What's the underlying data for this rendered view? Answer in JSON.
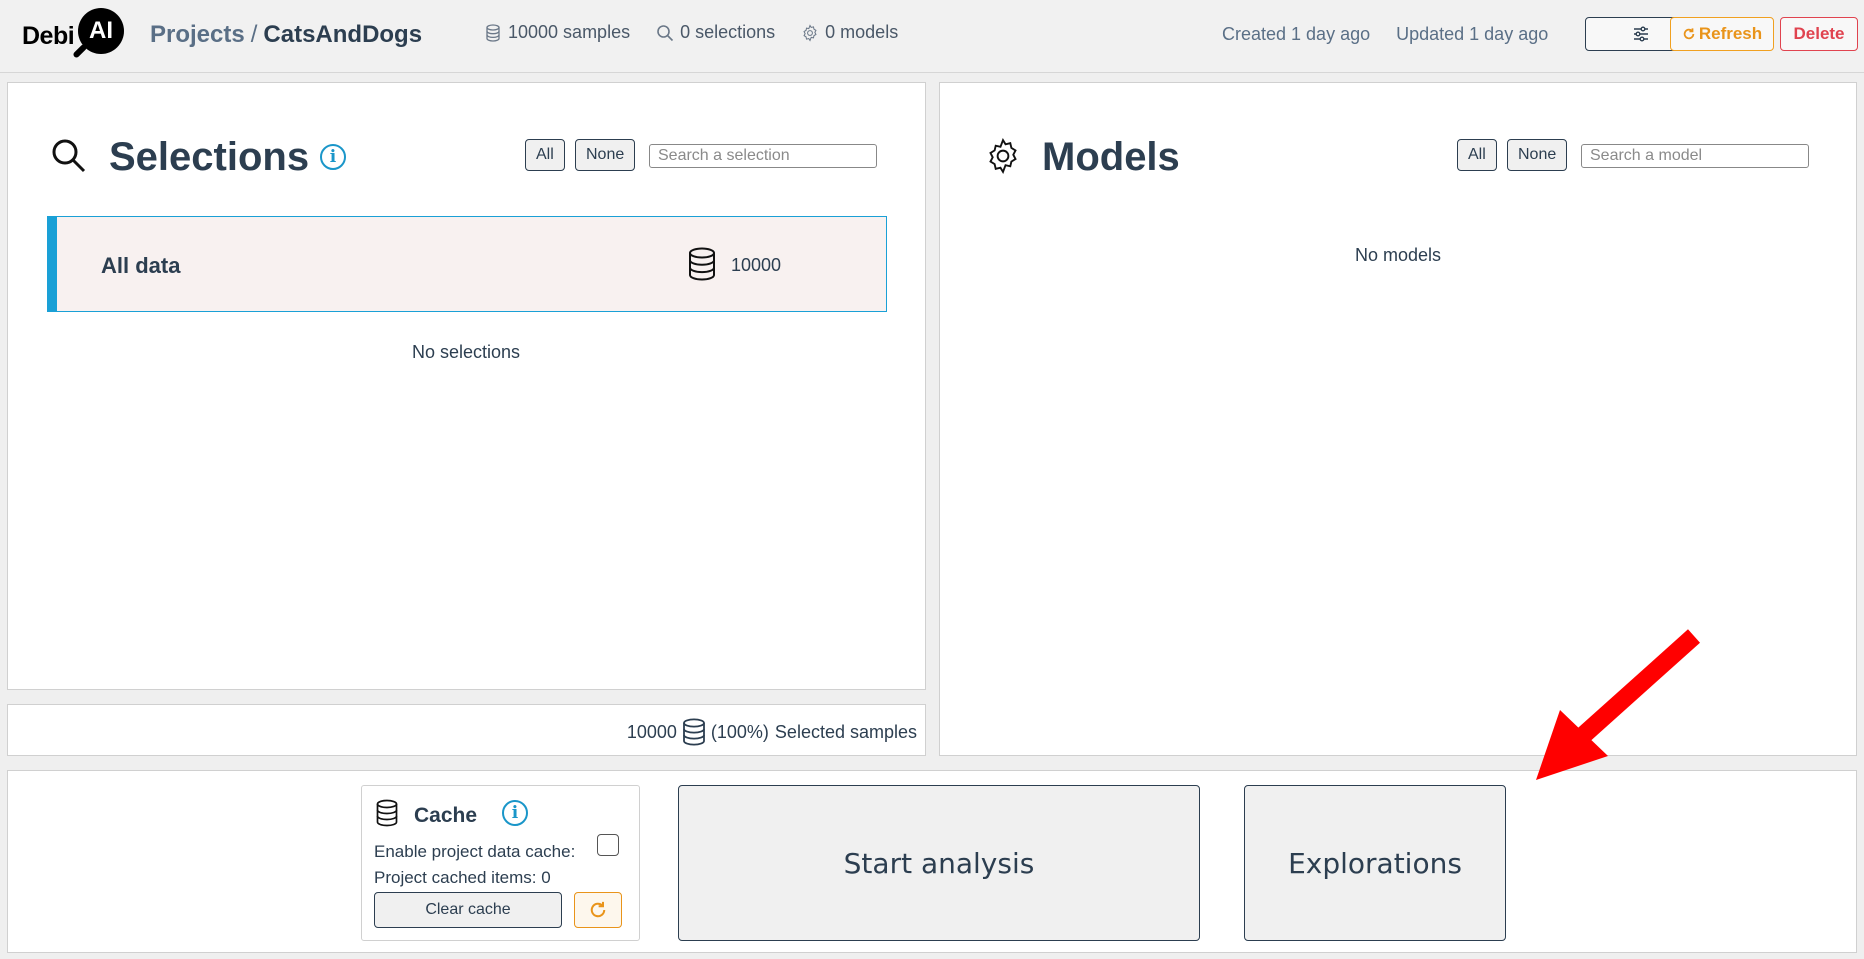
{
  "header": {
    "logo_text": "Debi",
    "logo_badge": "AI",
    "breadcrumb": {
      "parent": "Projects",
      "separator": "/",
      "current": "CatsAndDogs"
    },
    "stats": {
      "samples": "10000 samples",
      "selections": "0 selections",
      "models": "0 models"
    },
    "created": "Created 1 day ago",
    "updated": "Updated 1 day ago",
    "refresh_label": "Refresh",
    "delete_label": "Delete"
  },
  "selections": {
    "title": "Selections",
    "info_label": "i",
    "all_label": "All",
    "none_label": "None",
    "search_placeholder": "Search a selection",
    "all_data_label": "All data",
    "all_data_count": "10000",
    "empty_text": "No selections",
    "footer": {
      "count": "10000",
      "percent": "(100%)",
      "label": "Selected samples"
    }
  },
  "models": {
    "title": "Models",
    "all_label": "All",
    "none_label": "None",
    "search_placeholder": "Search a model",
    "empty_text": "No models"
  },
  "cache": {
    "title": "Cache",
    "info_label": "i",
    "enable_label": "Enable project data cache:",
    "enabled": false,
    "cached_items": "Project cached items: 0",
    "clear_label": "Clear cache"
  },
  "actions": {
    "start_analysis": "Start analysis",
    "explorations": "Explorations"
  },
  "colors": {
    "accent_blue": "#1aa0d6",
    "refresh_orange": "#e9941a",
    "delete_red": "#e0434f",
    "arrow_red": "#ff0000",
    "text_dark": "#2c3e50"
  }
}
